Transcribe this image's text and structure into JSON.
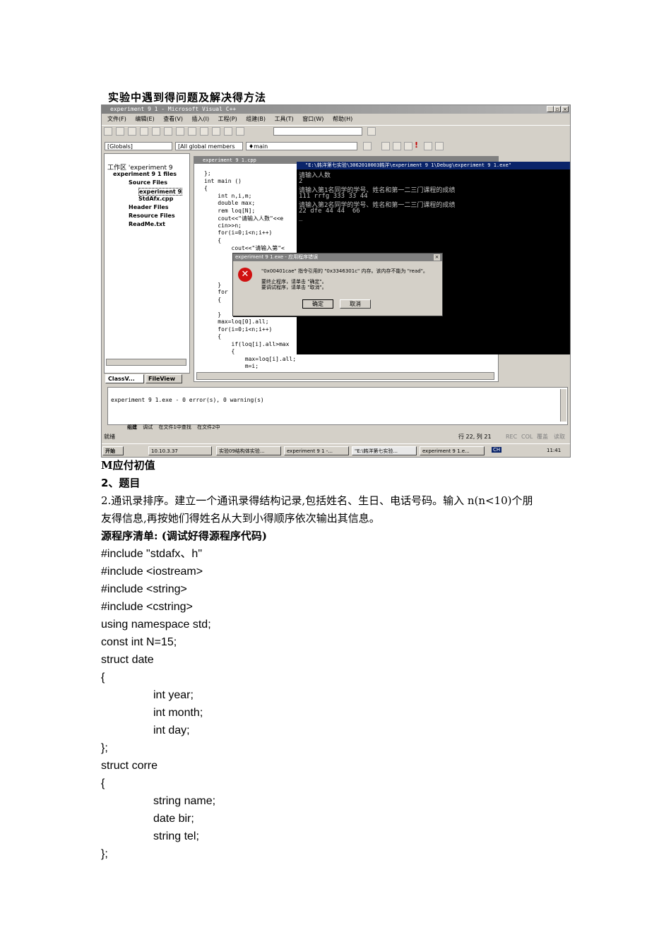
{
  "heading": "实验中遇到得问题及解决得方法",
  "screenshot": {
    "window_title": "experiment 9 1 - Microsoft Visual C++",
    "menu": [
      "文件(F)",
      "编辑(E)",
      "查看(V)",
      "插入(I)",
      "工程(P)",
      "组建(B)",
      "工具(T)",
      "窗口(W)",
      "帮助(H)"
    ],
    "combo_globals": "[Globals]",
    "combo_members": "[All global members",
    "combo_main": "♦main",
    "workspace": {
      "root": "工作区 'experiment 9",
      "project": "experiment 9 1 files",
      "source_folder": "Source Files",
      "file1": "experiment 9",
      "file2": "StdAfx.cpp",
      "header_folder": "Header Files",
      "resource_folder": "Resource Files",
      "readme": "ReadMe.txt",
      "tab_class": "ClassV...",
      "tab_file": "FileView"
    },
    "editor_title": "experiment 9 1.cpp",
    "code_lines": [
      "};",
      "int main ()",
      "{",
      "    int n,i,m;",
      "    double max;",
      "    rem loq[N];",
      "    cout<<\"请输入人数\"<<e",
      "    cin>>n;",
      "    for(i=0;i<n;i++)",
      "    {",
      "        cout<<\"请输入第\"<",
      "",
      "",
      "",
      "",
      "    }",
      "    for",
      "    {",
      "",
      "    }",
      "    max=loq[0].all;",
      "    for(i=0;i<n;i++)",
      "    {",
      "        if(loq[i].all>max",
      "        {",
      "            max=loq[i].all;",
      "            m=i;"
    ],
    "console": {
      "title": "\"E:\\韩洋第七实验\\3062010003韩洋\\experiment 9 1\\Debug\\experiment 9 1.exe\"",
      "lines": [
        "请输入人数",
        "2",
        "请输入第1名同学的学号、姓名和第一二三门课程的成绩",
        "111 rrfg 333 33 44",
        "请输入第2名同学的学号、姓名和第一二三门课程的成绩",
        "22 dfe 44 44  66",
        "_"
      ]
    },
    "dialog": {
      "title": "experiment 9 1.exe - 应用程序错误",
      "message": "\"0x00401cae\" 指令引用的 \"0x3346301c\" 内存。该内存不能为 \"read\"。",
      "line2": "要终止程序，请单击 \"确定\"。",
      "line3": "要调试程序，请单击 \"取消\"。",
      "ok": "确定",
      "cancel": "取消"
    },
    "output_text": "experiment 9 1.exe - 0 error(s), 0 warning(s)",
    "output_tabs": [
      "组建",
      "调试",
      "在文件1中查找",
      "在文件2中"
    ],
    "status_left": "就绪",
    "status_pos": "行 22, 列 21",
    "status_flags": [
      "REC",
      "COL",
      "覆盖",
      "读取"
    ],
    "taskbar": {
      "start": "开始",
      "ip": "10.10.3.37",
      "tasks": [
        "实验09结构体实验...",
        "experiment 9 1 -...",
        "\"E:\\韩洋第七实验...",
        "experiment 9 1.e..."
      ],
      "lang": "CH",
      "clock": "11:41"
    }
  },
  "body": {
    "line_m": "M应付初值",
    "section2": "2、题目",
    "problem_l1": "2.通讯录排序。建立一个通讯录得结构记录,包括姓名、生日、电话号码。输入 n(n<10)个朋",
    "problem_l2": "友得信息,再按她们得姓名从大到小得顺序依次输出其信息。",
    "listing_title": "源程序清单: (调试好得源程序代码)",
    "code": [
      "#include \"stdafx、h\"",
      "#include <iostream>",
      "#include <string>",
      "#include <cstring>",
      "using namespace std;",
      "const int N=15;",
      "struct date",
      "{",
      "int year;",
      "int month;",
      "int day;",
      "};",
      "struct corre",
      "{",
      "string name;",
      "date bir;",
      "string tel;",
      "};"
    ]
  }
}
